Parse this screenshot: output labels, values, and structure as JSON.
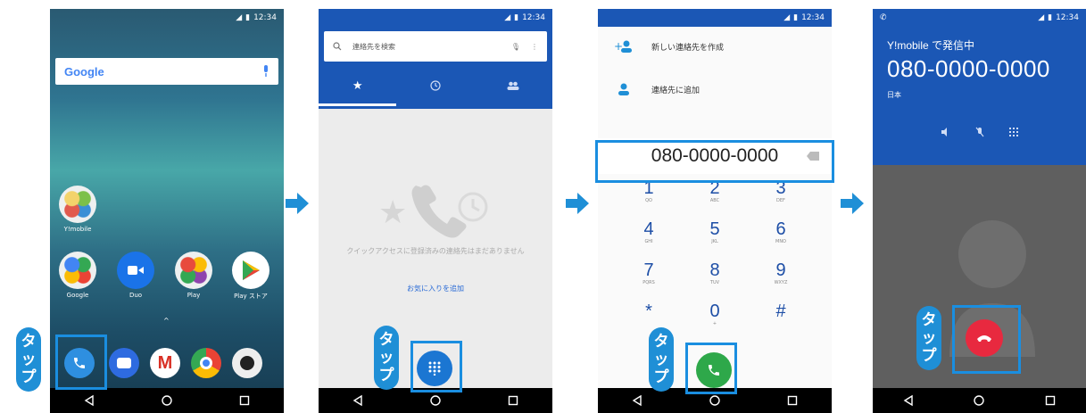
{
  "status": {
    "time": "12:34"
  },
  "callout": {
    "tap": [
      "タ",
      "ッ",
      "プ"
    ]
  },
  "screen1": {
    "google_label": "Google",
    "apps_row1": [
      {
        "label": "Y!mobile"
      }
    ],
    "apps_row2": [
      {
        "label": "Google"
      },
      {
        "label": "Duo"
      },
      {
        "label": "Play"
      },
      {
        "label": "Play ストア"
      }
    ]
  },
  "screen2": {
    "search_placeholder": "連絡先を検索",
    "empty_message": "クイックアクセスに登録済みの連絡先はまだありません",
    "add_favorite": "お気に入りを追加"
  },
  "screen3": {
    "create_contact": "新しい連絡先を作成",
    "add_to_contact": "連絡先に追加",
    "number": "080-0000-0000",
    "keys": [
      {
        "d": "1",
        "l": "QO"
      },
      {
        "d": "2",
        "l": "ABC"
      },
      {
        "d": "3",
        "l": "DEF"
      },
      {
        "d": "4",
        "l": "GHI"
      },
      {
        "d": "5",
        "l": "JKL"
      },
      {
        "d": "6",
        "l": "MNO"
      },
      {
        "d": "7",
        "l": "PQRS"
      },
      {
        "d": "8",
        "l": "TUV"
      },
      {
        "d": "9",
        "l": "WXYZ"
      },
      {
        "d": "*",
        "l": ""
      },
      {
        "d": "0",
        "l": "+"
      },
      {
        "d": "#",
        "l": ""
      }
    ]
  },
  "screen4": {
    "calling": "Y!mobile で発信中",
    "number": "080-0000-0000",
    "country": "日本"
  },
  "colors": {
    "accent": "#1f8fd6",
    "dial_green": "#2ea84a",
    "end_red": "#e8293f",
    "header_blue": "#1b57b5"
  }
}
